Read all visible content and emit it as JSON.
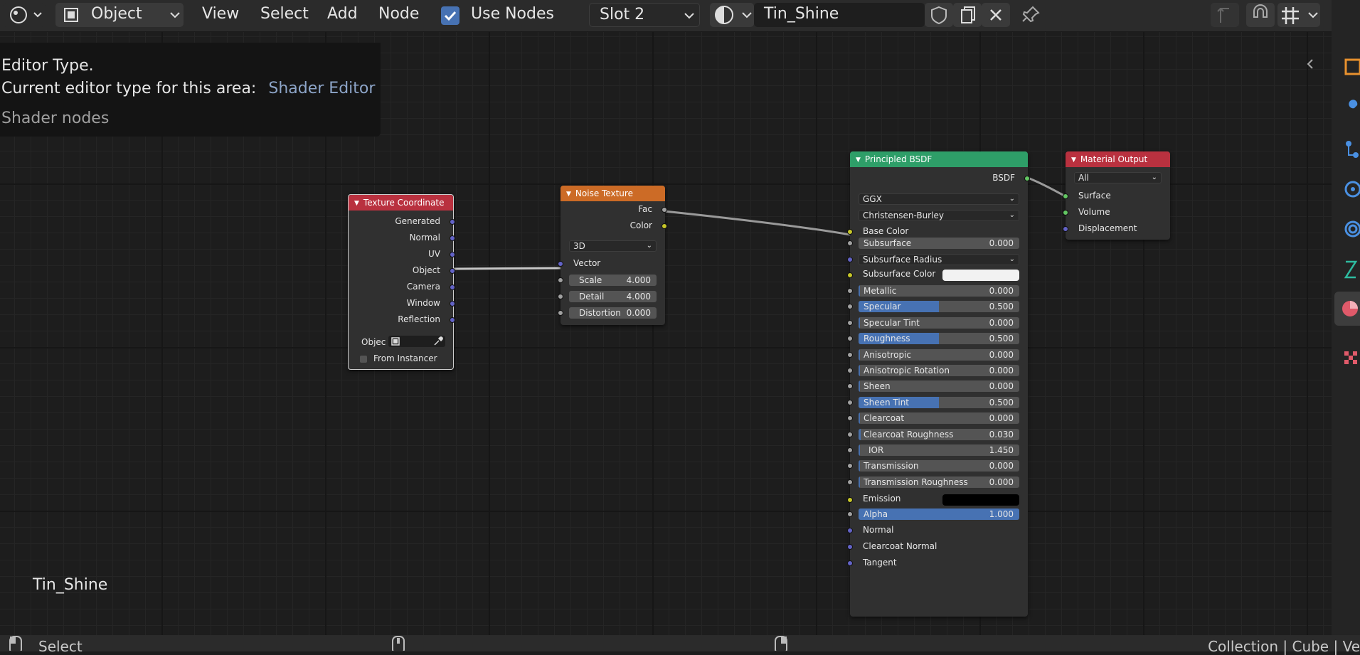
{
  "header": {
    "editor_type_icon": "shader-editor-icon",
    "mode": "Object",
    "menus": [
      "View",
      "Select",
      "Add",
      "Node"
    ],
    "use_nodes_checked": true,
    "use_nodes_label": "Use Nodes",
    "slot": "Slot 2",
    "material_name": "Tin_Shine"
  },
  "tooltip": {
    "title": "Editor Type.",
    "desc_prefix": "Current editor type for this area:",
    "desc_value": "Shader Editor",
    "python": "Shader nodes"
  },
  "material_label": "Tin_Shine",
  "nodes": {
    "texture_coordinate": {
      "title": "Texture Coordinate",
      "outputs": [
        "Generated",
        "Normal",
        "UV",
        "Object",
        "Camera",
        "Window",
        "Reflection"
      ],
      "object_label": "Objec",
      "from_instancer": "From Instancer"
    },
    "noise_texture": {
      "title": "Noise Texture",
      "outputs": [
        "Fac",
        "Color"
      ],
      "dimensions": "3D",
      "vector_label": "Vector",
      "fields": [
        {
          "label": "Scale",
          "value": "4.000"
        },
        {
          "label": "Detail",
          "value": "4.000"
        },
        {
          "label": "Distortion",
          "value": "0.000"
        }
      ]
    },
    "principled_bsdf": {
      "title": "Principled BSDF",
      "output": "BSDF",
      "distribution": "GGX",
      "subsurface_method": "Christensen-Burley",
      "base_color": "Base Color",
      "subsurface": {
        "label": "Subsurface",
        "value": "0.000"
      },
      "subsurface_radius": "Subsurface Radius",
      "subsurface_color": {
        "label": "Subsurface Color",
        "color": "#f2f2f2"
      },
      "fields": [
        {
          "label": "Metallic",
          "value": "0.000",
          "fill": 0
        },
        {
          "label": "Specular",
          "value": "0.500",
          "fill": 0.5
        },
        {
          "label": "Specular Tint",
          "value": "0.000",
          "fill": 0
        },
        {
          "label": "Roughness",
          "value": "0.500",
          "fill": 0.5
        },
        {
          "label": "Anisotropic",
          "value": "0.000",
          "fill": 0
        },
        {
          "label": "Anisotropic Rotation",
          "value": "0.000",
          "fill": 0
        },
        {
          "label": "Sheen",
          "value": "0.000",
          "fill": 0
        },
        {
          "label": "Sheen Tint",
          "value": "0.500",
          "fill": 0.5
        },
        {
          "label": "Clearcoat",
          "value": "0.000",
          "fill": 0
        },
        {
          "label": "Clearcoat Roughness",
          "value": "0.030",
          "fill": 0.03
        },
        {
          "label": "IOR",
          "value": "1.450",
          "fill": 0
        },
        {
          "label": "Transmission",
          "value": "0.000",
          "fill": 0
        },
        {
          "label": "Transmission Roughness",
          "value": "0.000",
          "fill": 0
        }
      ],
      "emission": {
        "label": "Emission",
        "color": "#000000"
      },
      "alpha": {
        "label": "Alpha",
        "value": "1.000",
        "fill": 1
      },
      "vector_inputs": [
        "Normal",
        "Clearcoat Normal",
        "Tangent"
      ]
    },
    "material_output": {
      "title": "Material Output",
      "target": "All",
      "inputs": [
        "Surface",
        "Volume",
        "Displacement"
      ]
    }
  },
  "statusbar": {
    "left": "Select",
    "right": "Collection | Cube | Ve"
  },
  "colors": {
    "input_node_header": "#b9313f",
    "texture_node_header": "#cc6b26",
    "shader_node_header": "#2e9e68",
    "output_node_header": "#b9313f",
    "accent": "#4772b3"
  }
}
